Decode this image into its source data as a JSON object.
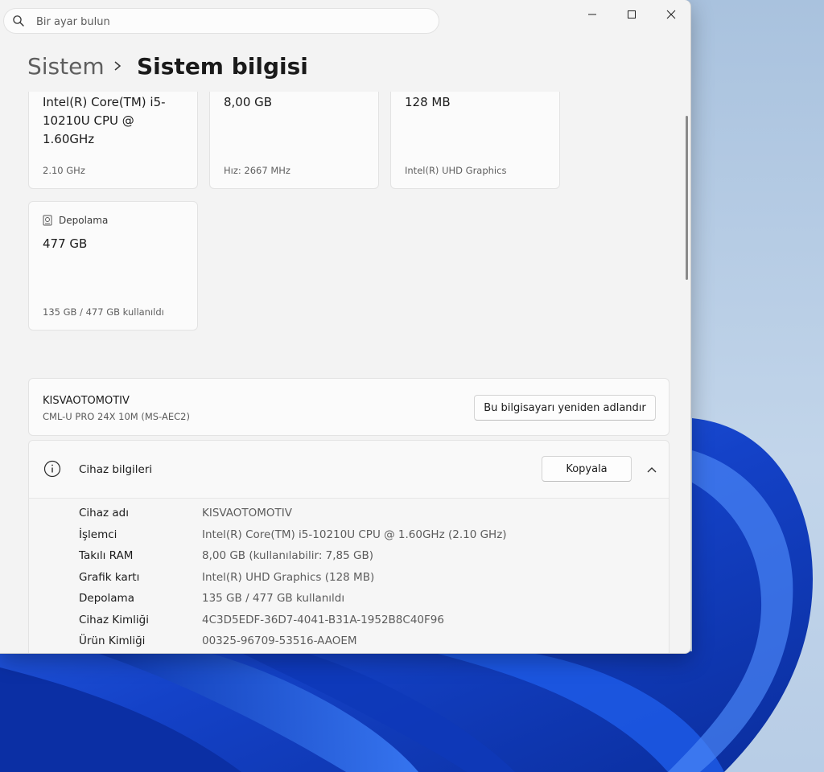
{
  "search": {
    "placeholder": "Bir ayar bulun"
  },
  "breadcrumb": {
    "parent": "Sistem",
    "current": "Sistem bilgisi"
  },
  "specs": {
    "cpu": {
      "value": "Intel(R) Core(TM) i5-10210U CPU @ 1.60GHz",
      "sub": "2.10 GHz"
    },
    "ram": {
      "value": "8,00 GB",
      "sub": "Hız: 2667 MHz"
    },
    "gpu": {
      "value": "128 MB",
      "sub": "Intel(R) UHD Graphics"
    },
    "storage": {
      "label": "Depolama",
      "value": "477 GB",
      "sub": "135 GB / 477 GB kullanıldı"
    }
  },
  "device": {
    "name": "KISVAOTOMOTIV",
    "model": "CML-U PRO 24X 10M (MS-AEC2)",
    "rename_label": "Bu bilgisayarı yeniden adlandır"
  },
  "device_info": {
    "title": "Cihaz bilgileri",
    "copy_label": "Kopyala",
    "rows": [
      {
        "key": "Cihaz adı",
        "value": "KISVAOTOMOTIV"
      },
      {
        "key": "İşlemci",
        "value": "Intel(R) Core(TM) i5-10210U CPU @ 1.60GHz (2.10 GHz)"
      },
      {
        "key": "Takılı RAM",
        "value": "8,00 GB (kullanılabilir: 7,85 GB)"
      },
      {
        "key": "Grafik kartı",
        "value": "Intel(R) UHD Graphics (128 MB)"
      },
      {
        "key": "Depolama",
        "value": "135 GB / 477 GB kullanıldı"
      },
      {
        "key": "Cihaz Kimliği",
        "value": "4C3D5EDF-36D7-4041-B31A-1952B8C40F96"
      },
      {
        "key": "Ürün Kimliği",
        "value": "00325-96709-53516-AAOEM"
      }
    ]
  },
  "icons": [
    "search-icon",
    "minimize-icon",
    "maximize-icon",
    "close-icon",
    "chevron-right-icon",
    "hard-drive-icon",
    "info-icon",
    "chevron-up-icon"
  ],
  "colors": {
    "window_bg": "#f3f3f3",
    "card_bg": "#fbfbfb",
    "wallpaper_blue": "#1a4fd8"
  }
}
